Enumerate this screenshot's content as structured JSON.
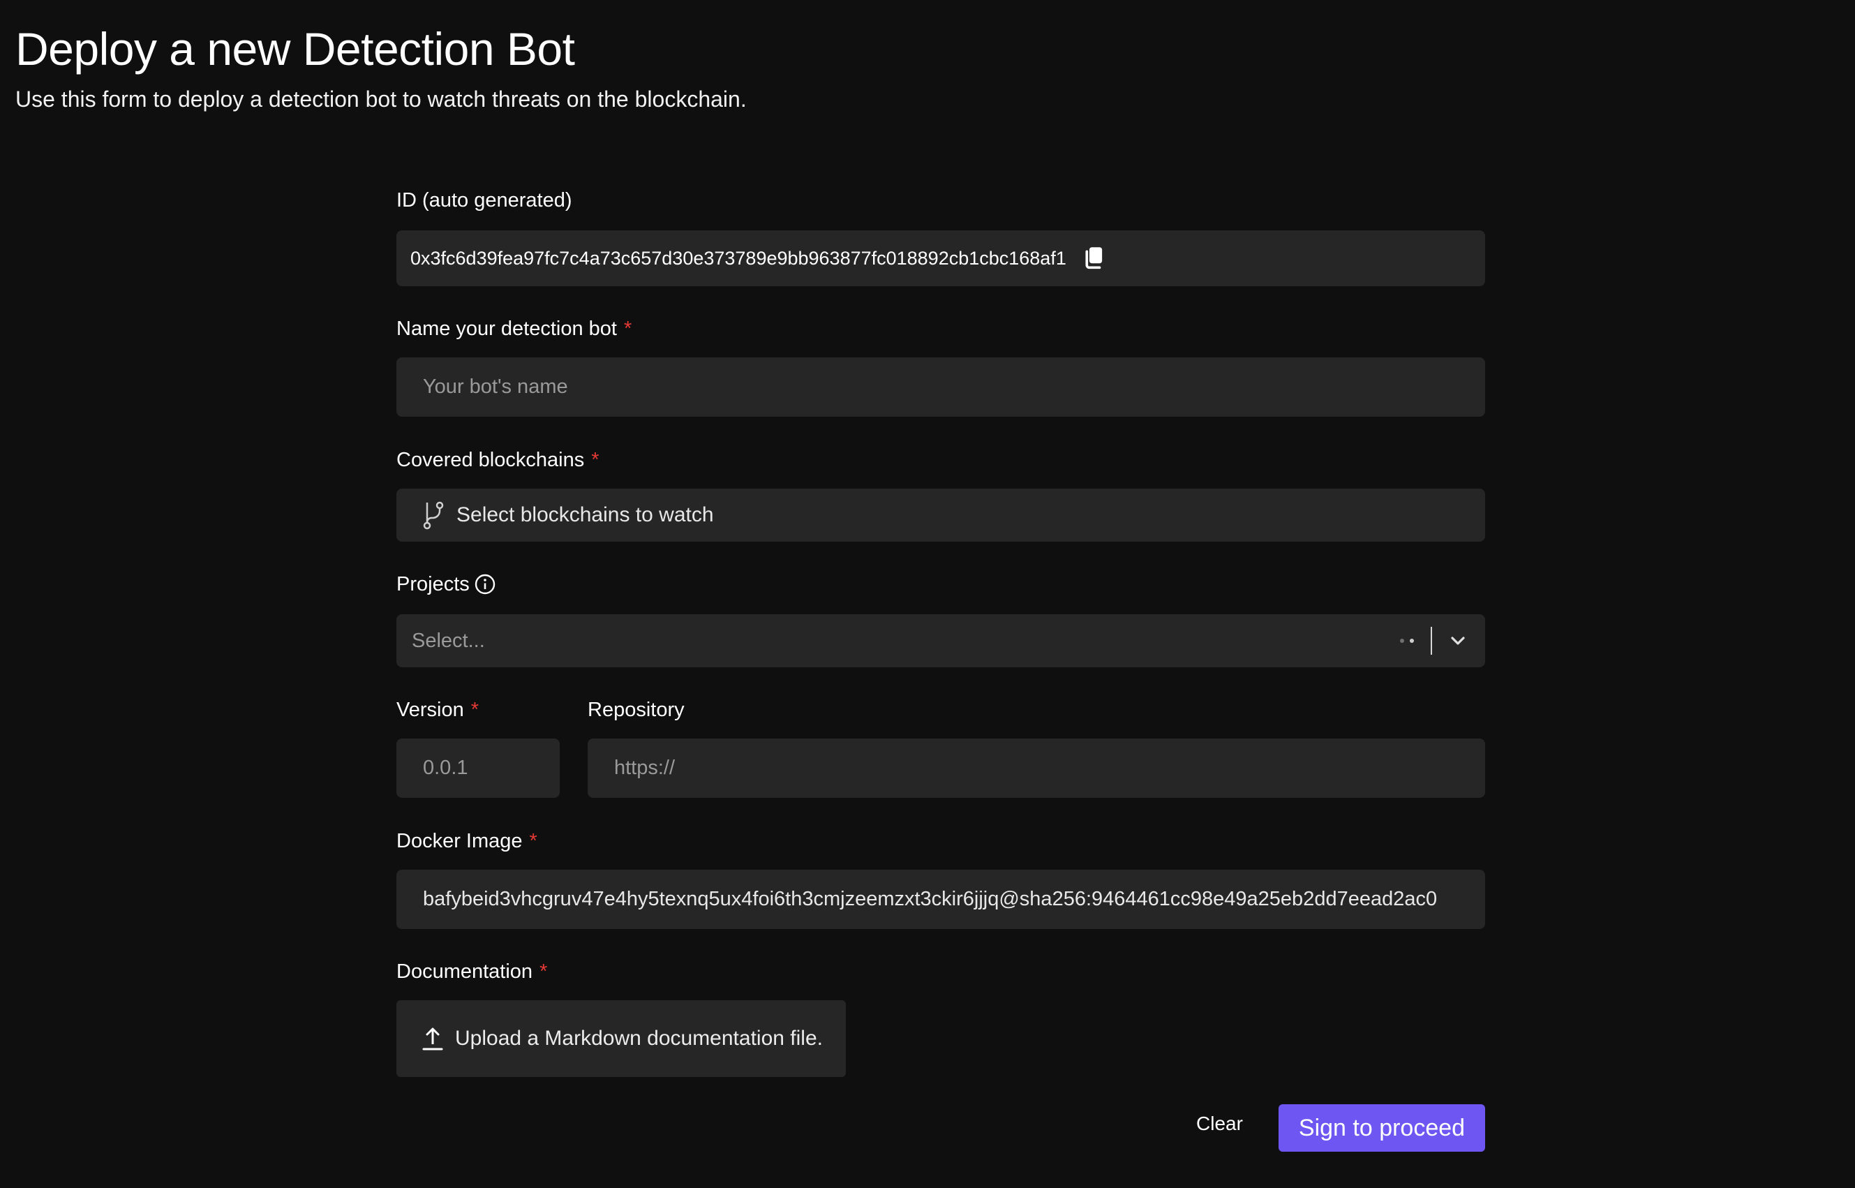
{
  "header": {
    "title": "Deploy a new Detection Bot",
    "subtitle": "Use this form to deploy a detection bot to watch threats on the blockchain."
  },
  "form": {
    "id_label": "ID (auto generated)",
    "id_value": "0x3fc6d39fea97fc7c4a73c657d30e373789e9bb963877fc018892cb1cbc168af1",
    "name_label": "Name your detection bot",
    "name_placeholder": "Your bot's name",
    "chains_label": "Covered blockchains",
    "chains_button": "Select blockchains to watch",
    "projects_label": "Projects",
    "projects_placeholder": "Select...",
    "version_label": "Version",
    "version_placeholder": "0.0.1",
    "repository_label": "Repository",
    "repository_placeholder": "https://",
    "docker_label": "Docker Image",
    "docker_value": "bafybeid3vhcgruv47e4hy5texnq5ux4foi6th3cmjzeemzxt3ckir6jjjq@sha256:9464461cc98e49a25eb2dd7eead2ac0",
    "docs_label": "Documentation",
    "docs_button": "Upload a Markdown documentation file.",
    "required_marker": "*"
  },
  "actions": {
    "clear_label": "Clear",
    "submit_label": "Sign to proceed"
  },
  "colors": {
    "background": "#0f0f0f",
    "field": "#262626",
    "accent": "#6e56f2",
    "required": "#e53935"
  }
}
